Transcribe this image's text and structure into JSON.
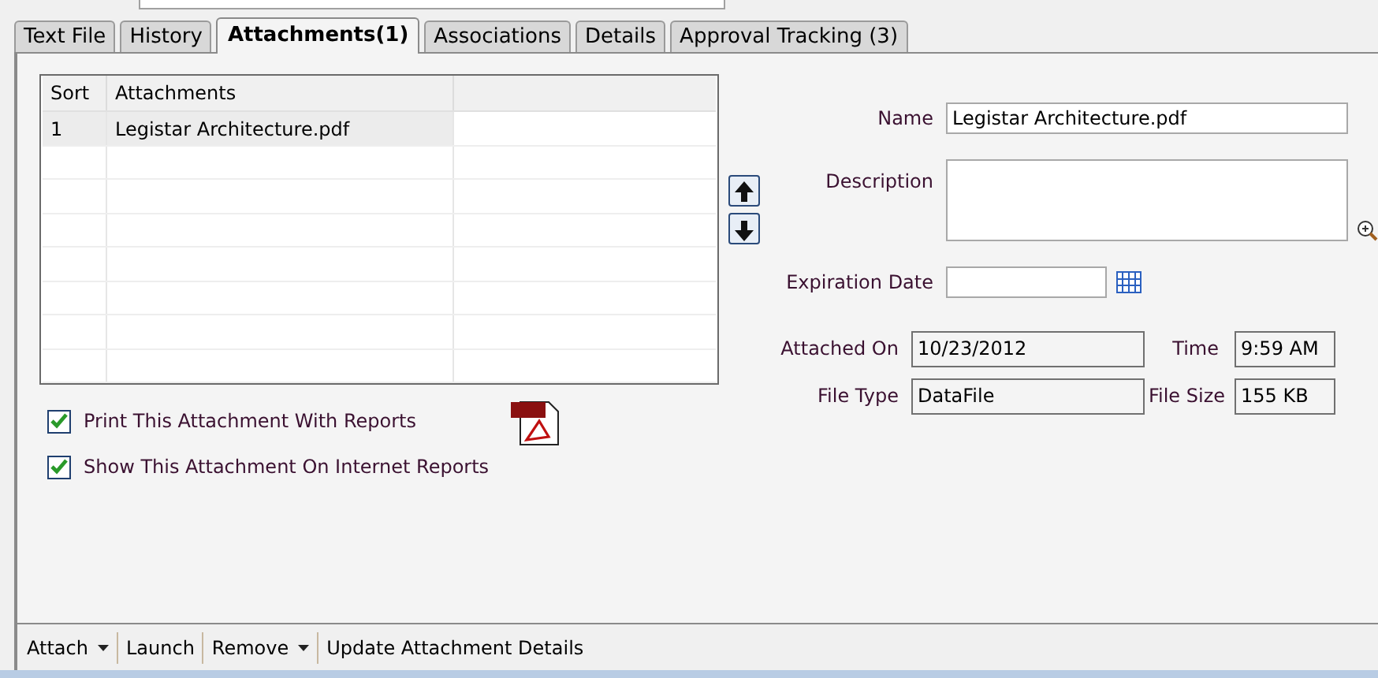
{
  "tabs": [
    {
      "label": "Text File",
      "selected": false
    },
    {
      "label": "History",
      "selected": false
    },
    {
      "label": "Attachments(1)",
      "selected": true
    },
    {
      "label": "Associations",
      "selected": false
    },
    {
      "label": "Details",
      "selected": false
    },
    {
      "label": "Approval Tracking (3)",
      "selected": false
    }
  ],
  "table": {
    "columns": [
      "Sort",
      "Attachments"
    ],
    "rows": [
      {
        "cells": [
          "1",
          "Legistar Architecture.pdf"
        ],
        "selected": true
      }
    ]
  },
  "checkboxes": [
    {
      "label": "Print This Attachment With Reports",
      "checked": true
    },
    {
      "label": "Show This Attachment On Internet Reports",
      "checked": true
    }
  ],
  "form": {
    "name_label": "Name",
    "name_value": "Legistar Architecture.pdf",
    "description_label": "Description",
    "expiration_label": "Expiration Date",
    "attached_on_label": "Attached On",
    "attached_on_value": "10/23/2012",
    "time_label": "Time",
    "time_value": "9:59 AM",
    "file_type_label": "File Type",
    "file_type_value": "DataFile",
    "file_size_label": "File Size",
    "file_size_value": "155 KB"
  },
  "toolbar": [
    {
      "label": "Attach",
      "dropdown": true
    },
    {
      "label": "Launch",
      "dropdown": false
    },
    {
      "label": "Remove",
      "dropdown": true
    },
    {
      "label": "Update Attachment Details",
      "dropdown": false
    }
  ]
}
